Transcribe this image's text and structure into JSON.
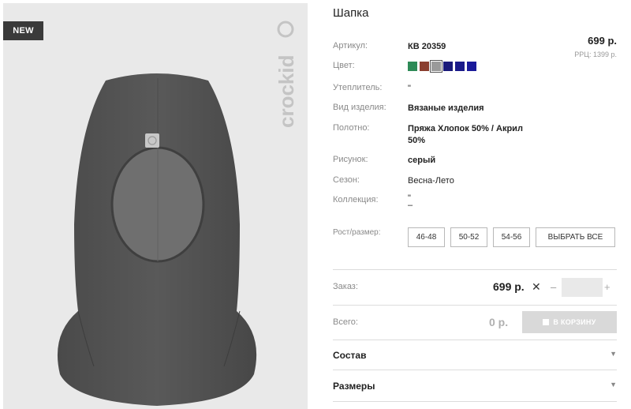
{
  "badge": "NEW",
  "brand": "crockid",
  "product": {
    "title": "Шапка",
    "price": "699 р.",
    "rrp": "РРЦ: 1399 р."
  },
  "specs": [
    {
      "label": "Артикул:",
      "value": "КВ 20359"
    },
    {
      "label": "Цвет:",
      "value": ""
    },
    {
      "label": "Утеплитель:",
      "value": "\""
    },
    {
      "label": "Вид изделия:",
      "value": "Вязаные изделия"
    },
    {
      "label": "Полотно:",
      "value": "Пряжа Хлопок 50% / Акрил 50%"
    },
    {
      "label": "Рисунок:",
      "value": "серый"
    },
    {
      "label": "Сезон:",
      "value": "Весна-Лето"
    },
    {
      "label": "Коллекция:",
      "value": "\"\n–"
    }
  ],
  "colors": [
    {
      "hex": "#2e8a57",
      "selected": false
    },
    {
      "hex": "#8a3e2f",
      "selected": false
    },
    {
      "hex": "#9a9a9a",
      "selected": true
    },
    {
      "hex": "#1a1a7a",
      "selected": false
    },
    {
      "hex": "#1a1a8a",
      "selected": false
    },
    {
      "hex": "#1a1a9a",
      "selected": false
    }
  ],
  "sizes": {
    "label": "Рост/размер:",
    "options": [
      "46-48",
      "50-52",
      "54-56"
    ],
    "select_all": "ВЫБРАТЬ ВСЕ"
  },
  "order": {
    "label": "Заказ:",
    "price": "699 р.",
    "times": "✕",
    "minus": "–",
    "plus": "+",
    "qty": ""
  },
  "total": {
    "label": "Всего:",
    "value": "0 р.",
    "cart_button": "В КОРЗИНУ"
  },
  "accordions": [
    {
      "label": "Состав"
    },
    {
      "label": "Размеры"
    }
  ]
}
